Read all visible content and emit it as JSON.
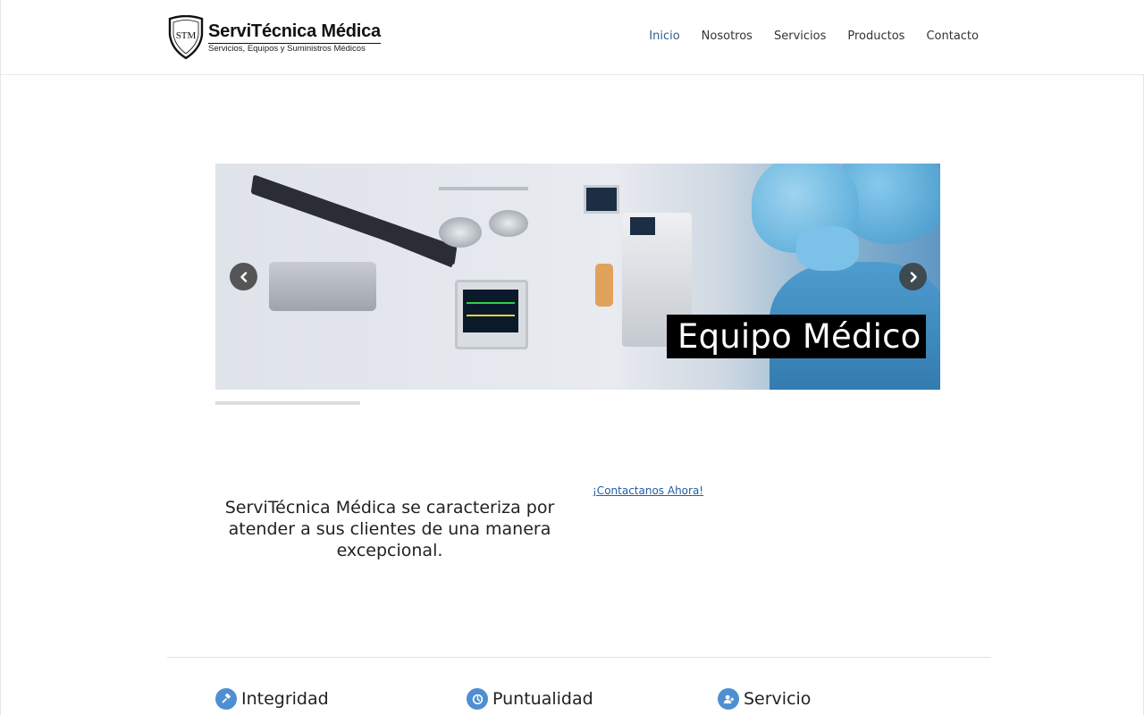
{
  "brand": {
    "logo_monogram": "STM",
    "title": "ServiTécnica Médica",
    "subtitle": "Servicios, Equipos y Suministros Médicos"
  },
  "nav": {
    "items": [
      {
        "label": "Inicio",
        "active": true
      },
      {
        "label": "Nosotros",
        "active": false
      },
      {
        "label": "Servicios",
        "active": false
      },
      {
        "label": "Productos",
        "active": false
      },
      {
        "label": "Contacto",
        "active": false
      }
    ]
  },
  "slider": {
    "caption": "Equipo Médico",
    "prev_icon": "chevron-left-icon",
    "next_icon": "chevron-right-icon",
    "progress_fraction": 0.2
  },
  "intro": {
    "tagline": "ServiTécnica Médica se caracteriza por atender a sus clientes de una manera excepcional.",
    "contact_link": "¡Contactanos Ahora!"
  },
  "features": [
    {
      "title": "Integridad",
      "icon": "gavel-icon"
    },
    {
      "title": "Puntualidad",
      "icon": "clock-icon"
    },
    {
      "title": "Servicio",
      "icon": "user-plus-icon"
    }
  ],
  "colors": {
    "accent": "#4e8fd1",
    "nav_active": "#2f5e8f",
    "link": "#1f5fa7"
  }
}
